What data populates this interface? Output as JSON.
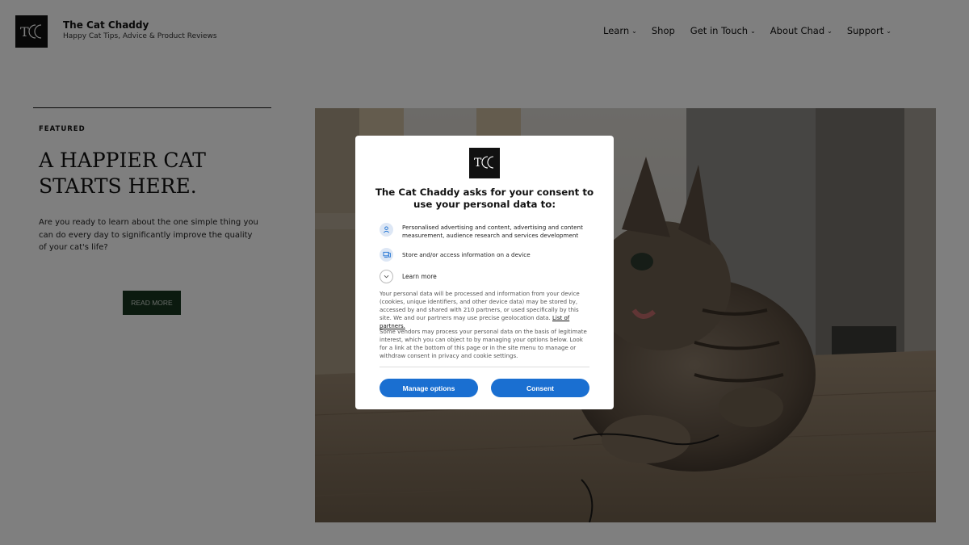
{
  "site": {
    "logo_text": "TCC",
    "logo_subtext": "THE CAT CHADDY",
    "title": "The Cat Chaddy",
    "tagline": "Happy Cat Tips, Advice & Product Reviews"
  },
  "nav": {
    "items": [
      {
        "label": "Learn",
        "dropdown": true
      },
      {
        "label": "Shop",
        "dropdown": false
      },
      {
        "label": "Get in Touch",
        "dropdown": true
      },
      {
        "label": "About Chad",
        "dropdown": true
      },
      {
        "label": "Support",
        "dropdown": true
      }
    ]
  },
  "featured": {
    "label": "FEATURED",
    "heading": "A HAPPIER CAT STARTS HERE.",
    "text": "Are you ready to learn about the one simple thing you can do every day to significantly improve the quality of your cat's life?",
    "button": "READ MORE"
  },
  "consent": {
    "logo_text": "TCC",
    "logo_subtext": "THE CAT CHADDY",
    "title": "The Cat Chaddy asks for your consent to use your personal data to:",
    "purposes": [
      {
        "icon": "person-icon",
        "text": "Personalised advertising and content, advertising and content measurement, audience research and services development"
      },
      {
        "icon": "device-icon",
        "text": "Store and/or access information on a device"
      }
    ],
    "learn_more": "Learn more",
    "paragraph1": "Your personal data will be processed and information from your device (cookies, unique identifiers, and other device data) may be stored by, accessed by and shared with 210 partners, or used specifically by this site. We and our partners may use precise geolocation data.",
    "partners_link": "List of partners.",
    "paragraph2": "Some vendors may process your personal data on the basis of legitimate interest, which you can object to by managing your options below. Look for a link at the bottom of this page or in the site menu to manage or withdraw consent in privacy and cookie settings.",
    "manage_button": "Manage options",
    "consent_button": "Consent"
  },
  "colors": {
    "accent": "#1a6fd1",
    "read_more_bg": "#17351f"
  }
}
